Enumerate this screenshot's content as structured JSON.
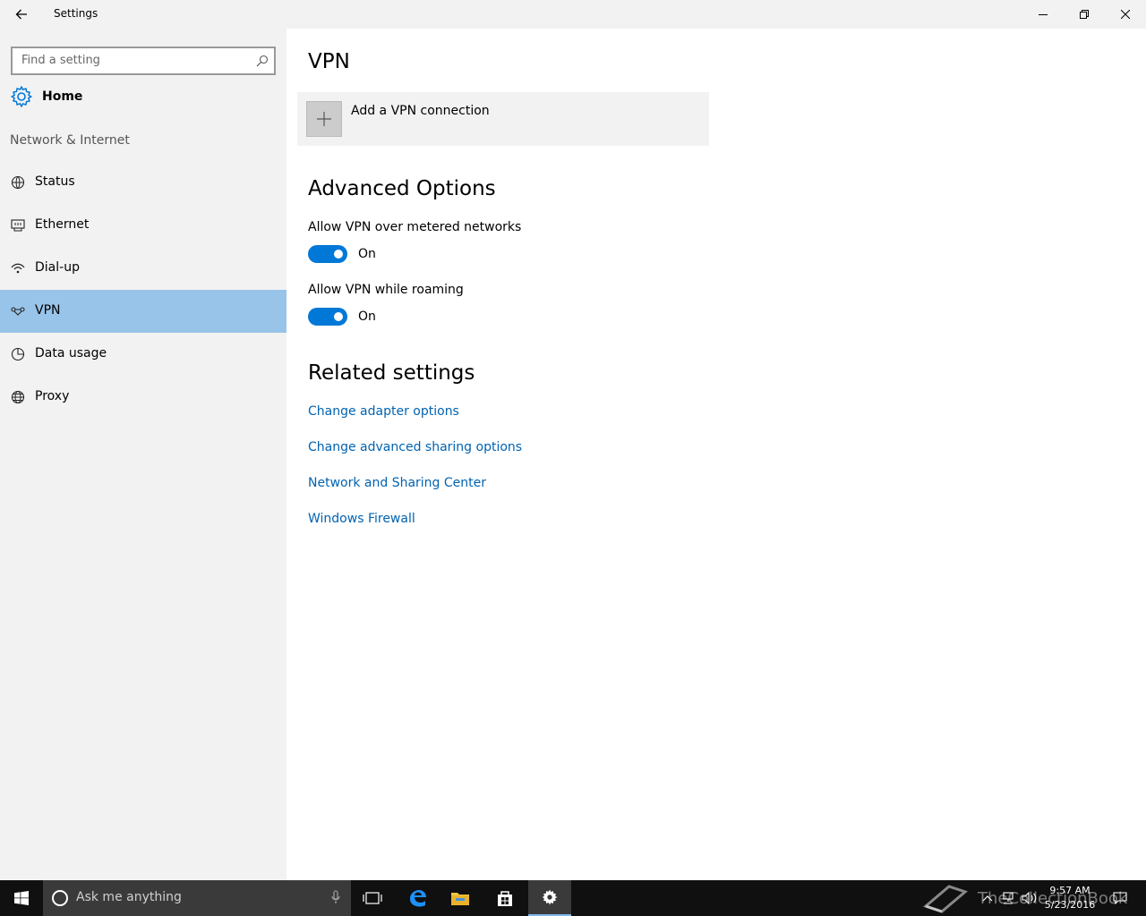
{
  "window": {
    "title": "Settings"
  },
  "sidebar": {
    "search_placeholder": "Find a setting",
    "home_label": "Home",
    "section_title": "Network & Internet",
    "items": [
      {
        "label": "Status",
        "icon": "status-icon"
      },
      {
        "label": "Ethernet",
        "icon": "ethernet-icon"
      },
      {
        "label": "Dial-up",
        "icon": "dialup-icon"
      },
      {
        "label": "VPN",
        "icon": "vpn-icon",
        "active": true
      },
      {
        "label": "Data usage",
        "icon": "data-usage-icon"
      },
      {
        "label": "Proxy",
        "icon": "globe-icon"
      }
    ]
  },
  "main": {
    "title": "VPN",
    "add_vpn_label": "Add a VPN connection",
    "advanced_title": "Advanced Options",
    "options": [
      {
        "label": "Allow VPN over metered networks",
        "state": "On"
      },
      {
        "label": "Allow VPN while roaming",
        "state": "On"
      }
    ],
    "related_title": "Related settings",
    "links": [
      "Change adapter options",
      "Change advanced sharing options",
      "Network and Sharing Center",
      "Windows Firewall"
    ]
  },
  "taskbar": {
    "search_placeholder": "Ask me anything",
    "time": "9:57 AM",
    "date": "5/23/2016",
    "watermark": "TheCollectionBook"
  },
  "colors": {
    "accent": "#0078d7",
    "link": "#0063b1",
    "sidebar_bg": "#f2f2f2",
    "active_item": "#99c4e9",
    "taskbar": "#101010"
  }
}
